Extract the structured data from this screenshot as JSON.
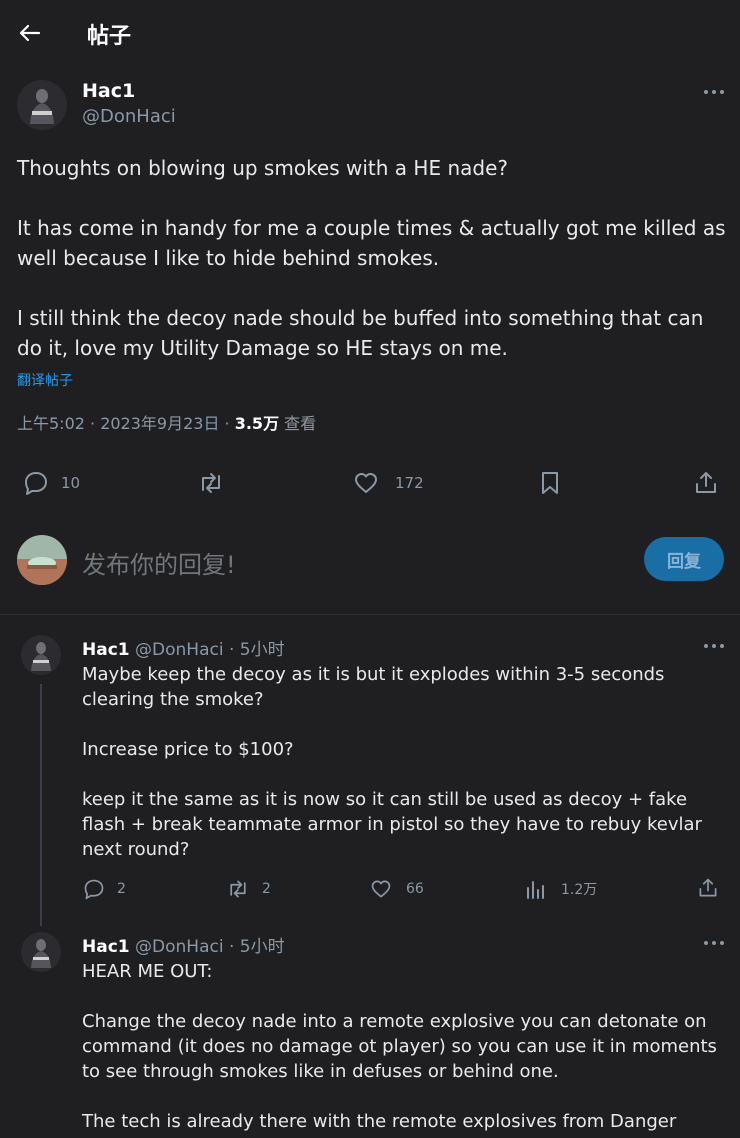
{
  "header": {
    "title": "帖子"
  },
  "post": {
    "author_name": "Hac1",
    "author_handle": "@DonHaci",
    "text": "Thoughts on blowing up smokes with a HE nade?\n\nIt has come in handy for me a couple times & actually got me killed as well because I like to hide behind smokes.\n\nI still think the decoy nade should be buffed into something that can do it, love my Utility Damage so HE stays on me.",
    "translate": "翻译帖子",
    "time": "上午5:02 · 2023年9月23日 · ",
    "views_count": "3.5万",
    "views_label": " 查看",
    "actions": {
      "replies": "10",
      "retweets": "",
      "likes": "172"
    }
  },
  "composer": {
    "placeholder": "发布你的回复!",
    "button": "回复"
  },
  "replies": [
    {
      "author_name": "Hac1",
      "author_handle": "@DonHaci",
      "time": " · 5小时",
      "text": "Maybe keep the decoy as it is but it explodes within 3-5 seconds clearing the smoke?\n\nIncrease price to $100?\n\nkeep it the same as it is now so it can still be used as decoy + fake flash + break teammate armor in pistol so they have to rebuy kevlar next round?",
      "actions": {
        "replies": "2",
        "retweets": "2",
        "likes": "66",
        "views": "1.2万"
      }
    },
    {
      "author_name": "Hac1",
      "author_handle": "@DonHaci",
      "time": " · 5小时",
      "text": "HEAR ME OUT:\n\nChange the decoy nade into a remote explosive you can detonate on command (it does no damage ot player) so you can use it in moments to see through smokes like in defuses or behind one.\n\nThe tech is already there with the remote explosives from Danger Zone."
    }
  ],
  "colors": {
    "background": "#1f1f22",
    "accent": "#1d9bf0",
    "muted": "#8b98a5"
  }
}
